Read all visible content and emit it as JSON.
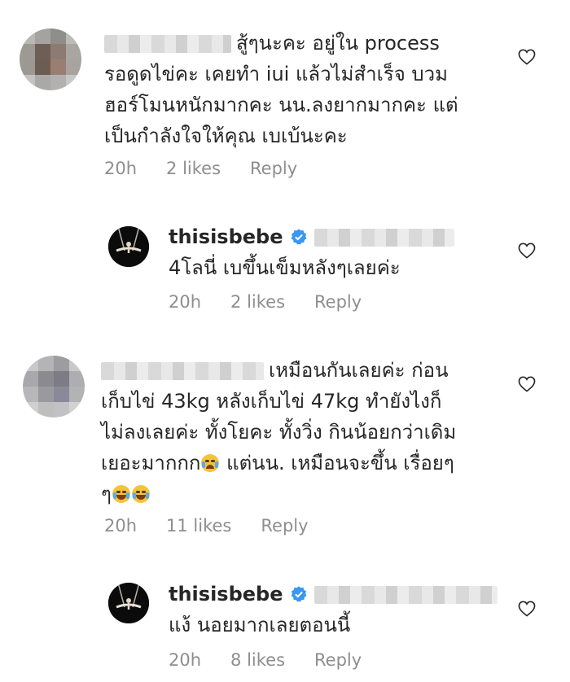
{
  "comments": [
    {
      "text_lines": [
        "สู้ๆนะคะ อยู่ใน process",
        "รอดูดไข่คะ เคยทำ iui แล้วไม่สำเร็จ บวม",
        "ฮอร์โมนหนักมากคะ นน.ลงยากมากคะ แต่",
        "เป็นกำลังใจให้คุณ เบเบ้นะคะ"
      ],
      "time": "20h",
      "likes": "2 likes",
      "reply": "Reply"
    },
    {
      "username": "thisisbebe",
      "text_lines": [
        "4โลนี่ เบขึ้นเข็มหลังๆเลยค่ะ"
      ],
      "time": "20h",
      "likes": "2 likes",
      "reply": "Reply"
    },
    {
      "text_lines": [
        "เหมือนกันเลยค่ะ ก่อน",
        "เก็บไข่ 43kg หลังเก็บไข่ 47kg ทำยังไงก็",
        "ไม่ลงเลยค่ะ ทั้งโยคะ ทั้งวิ่ง กินน้อยกว่าเดิม"
      ],
      "text_line4_a": "เยอะมากกก",
      "text_line4_b": "แต่นน. เหมือนจะขึ้น เรื่อยๆ",
      "text_line5": "ๆ",
      "time": "20h",
      "likes": "11 likes",
      "reply": "Reply"
    },
    {
      "username": "thisisbebe",
      "text_lines": [
        "แง้ นอยมากเลยตอนนี้"
      ],
      "time": "20h",
      "likes": "8 likes",
      "reply": "Reply"
    }
  ],
  "icons": {
    "like": "heart-outline-icon",
    "verified": "verified-badge-icon",
    "emoji_crying": "loudly-crying-face",
    "emoji_laughing": "face-with-tears-of-joy"
  },
  "colors": {
    "text": "#262626",
    "meta": "#8e8e8e",
    "verified": "#3897f0"
  }
}
